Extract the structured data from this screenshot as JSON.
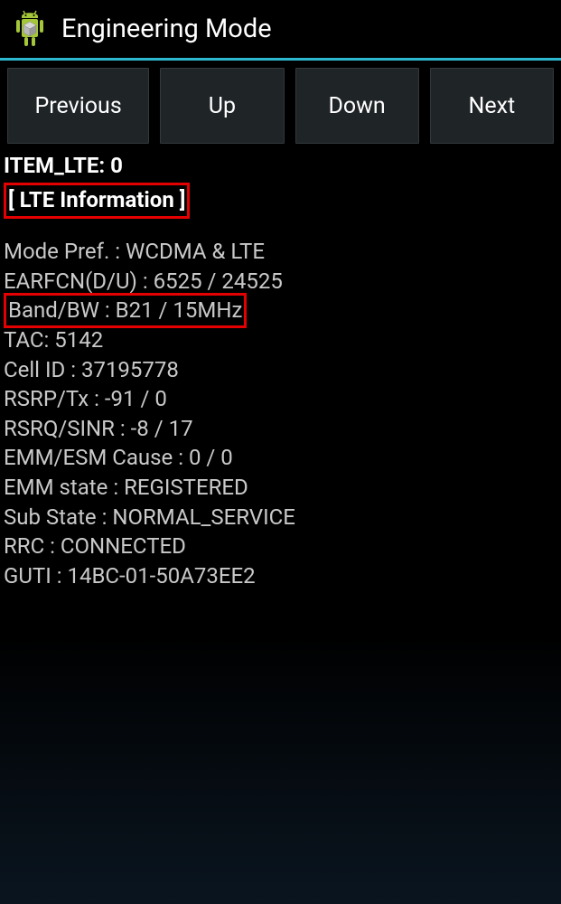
{
  "header": {
    "title": "Engineering Mode"
  },
  "buttons": {
    "previous": "Previous",
    "up": "Up",
    "down": "Down",
    "next": "Next"
  },
  "item_label": "ITEM_LTE: 0",
  "section_title": "[ LTE Information ]",
  "rows": {
    "mode_pref": "Mode Pref. : WCDMA & LTE",
    "earfcn": "EARFCN(D/U) :  6525 / 24525",
    "band_bw": "Band/BW :  B21 / 15MHz",
    "tac": "TAC:  5142",
    "cell_id": "Cell ID :  37195778",
    "rsrp_tx": "RSRP/Tx :  -91 / 0",
    "rsrq_sinr": "RSRQ/SINR :  -8 / 17",
    "emm_esm_cause": "EMM/ESM Cause :  0 / 0",
    "emm_state": "EMM state :  REGISTERED",
    "sub_state": "Sub State :  NORMAL_SERVICE",
    "rrc": "RRC :  CONNECTED",
    "guti": "GUTI :  14BC-01-50A73EE2"
  }
}
